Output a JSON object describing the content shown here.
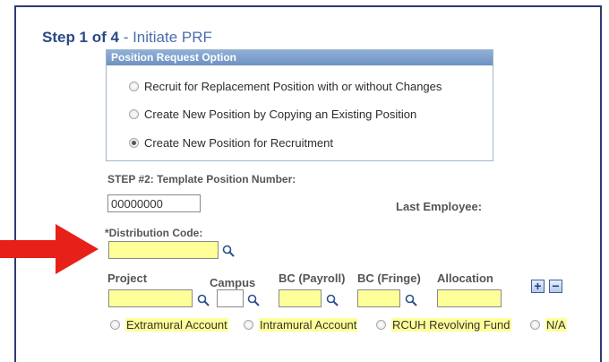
{
  "header": {
    "step_label": "Step 1 of 4",
    "step_name": " - Initiate PRF"
  },
  "position_request": {
    "title": "Position Request Option",
    "options": [
      {
        "label": "Recruit for Replacement Position with or without Changes",
        "selected": false
      },
      {
        "label": "Create New Position by Copying an Existing Position",
        "selected": false
      },
      {
        "label": "Create New Position for Recruitment",
        "selected": true
      }
    ]
  },
  "step2": {
    "label": "STEP #2: Template Position Number:",
    "value": "00000000",
    "last_employee_label": "Last Employee:"
  },
  "distribution": {
    "label": "*Distribution Code:",
    "value": ""
  },
  "fields": {
    "project_label": "Project",
    "campus_label": "Campus",
    "bc_payroll_label": "BC (Payroll)",
    "bc_fringe_label": "BC (Fringe)",
    "allocation_label": "Allocation"
  },
  "buttons": {
    "add": "+",
    "remove": "−"
  },
  "accounts": [
    {
      "label": "Extramural Account",
      "selected": false
    },
    {
      "label": "Intramural Account",
      "selected": false
    },
    {
      "label": "RCUH Revolving Fund",
      "selected": false
    },
    {
      "label": "N/A",
      "selected": false
    }
  ],
  "colors": {
    "highlight": "#ffff99",
    "arrow": "#e8201a",
    "title": "#2b4a86"
  }
}
